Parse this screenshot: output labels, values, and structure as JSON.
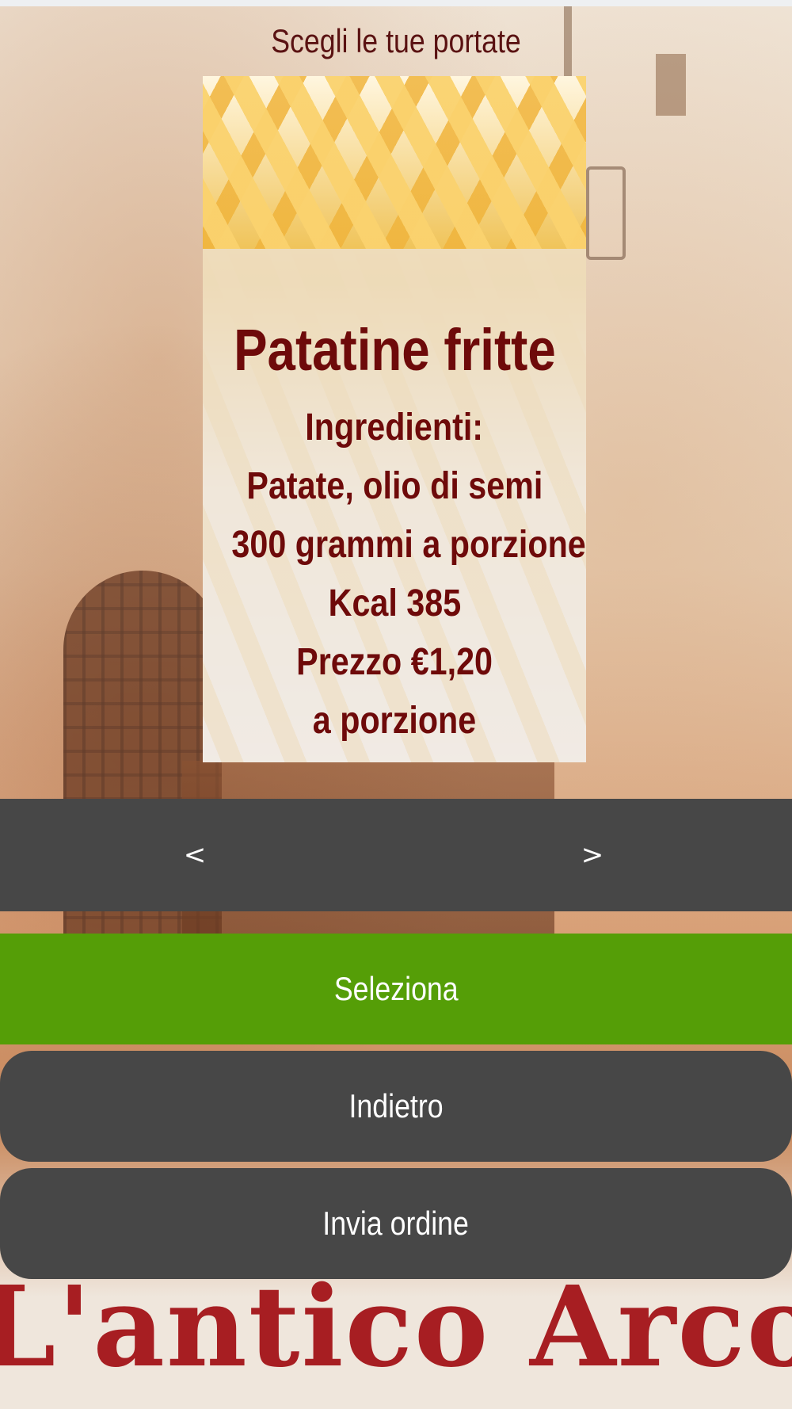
{
  "header": {
    "title": "Scegli le tue portate"
  },
  "dish": {
    "name": "Patatine fritte",
    "lines": [
      "Ingredienti:",
      "Patate, olio di semi",
      "300 grammi a porzione",
      "Kcal 385",
      "Prezzo €1,20",
      "a porzione"
    ]
  },
  "carousel": {
    "prev_label": "<",
    "next_label": ">"
  },
  "actions": {
    "select_label": "Seleziona",
    "back_label": "Indietro",
    "send_label": "Invia ordine"
  },
  "background": {
    "sign_text": "L'antico Arco"
  },
  "colors": {
    "accent_green": "#559e07",
    "button_gray": "#474747",
    "text_dark_red": "#6e0a0a",
    "sign_red": "#a71e22"
  }
}
